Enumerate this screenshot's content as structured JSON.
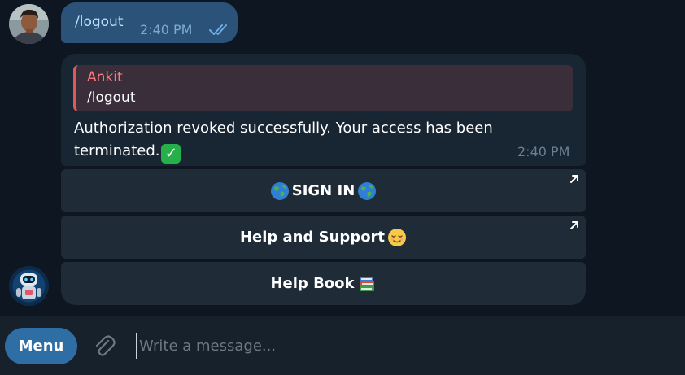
{
  "messages": {
    "outgoing": {
      "text": "/logout",
      "time": "2:40 PM",
      "status_icon": "double-check-icon"
    },
    "incoming": {
      "reply_to": {
        "name": "Ankit",
        "text": "/logout"
      },
      "text": "Authorization revoked successfully. Your access has been terminated.",
      "time": "2:40 PM"
    }
  },
  "keyboard": {
    "buttons": [
      {
        "label": "SIGN IN",
        "emoji": "globe-icon",
        "external": true
      },
      {
        "label": "Help and Support",
        "emoji": "relieved-face-icon",
        "external": true
      },
      {
        "label": "Help Book",
        "emoji": "books-icon",
        "external": false
      }
    ]
  },
  "composer": {
    "menu_label": "Menu",
    "placeholder": "Write a message...",
    "value": ""
  },
  "colors": {
    "background": "#0e1621",
    "outgoing_bubble": "#2b5278",
    "incoming_bubble": "#182533",
    "reply_accent": "#e0575a",
    "menu_button": "#2f6ea5"
  }
}
